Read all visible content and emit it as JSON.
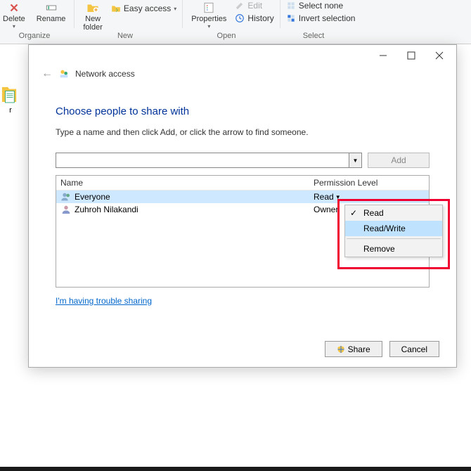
{
  "ribbon": {
    "delete": "Delete",
    "rename": "Rename",
    "new_folder": "New\nfolder",
    "easy_access": "Easy access",
    "properties": "Properties",
    "edit": "Edit",
    "history": "History",
    "select_none": "Select none",
    "invert_selection": "Invert selection",
    "groups": {
      "organize": "Organize",
      "new": "New",
      "open": "Open",
      "select": "Select"
    }
  },
  "thumb_label": "r",
  "dialog": {
    "title": "Network access",
    "heading": "Choose people to share with",
    "instruction": "Type a name and then click Add, or click the arrow to find someone.",
    "add": "Add",
    "columns": {
      "name": "Name",
      "perm": "Permission Level"
    },
    "rows": [
      {
        "name": "Everyone",
        "perm": "Read",
        "selected": true
      },
      {
        "name": "Zuhroh Nilakandi",
        "perm": "Owner",
        "selected": false
      }
    ],
    "trouble": "I'm having trouble sharing",
    "share": "Share",
    "cancel": "Cancel"
  },
  "menu": {
    "read": "Read",
    "readwrite": "Read/Write",
    "remove": "Remove"
  }
}
